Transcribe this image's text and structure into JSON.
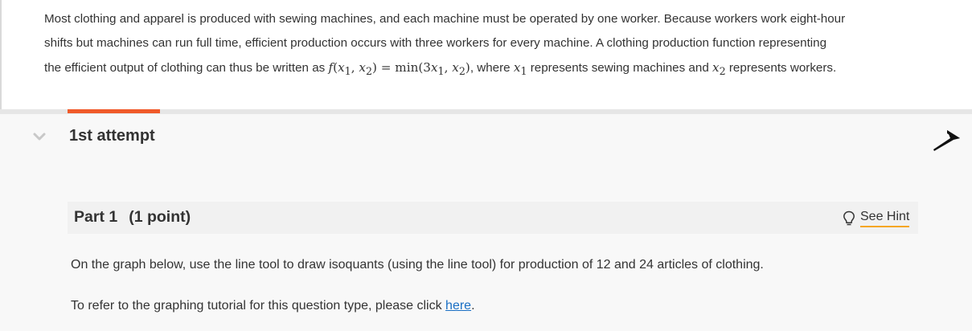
{
  "intro": {
    "line1": "Most clothing and apparel is produced with sewing machines, and each machine must be operated by one worker. Because workers work eight-hour",
    "line2": "shifts but machines can run full time, efficient production occurs with three workers for every machine. A clothing production function representing",
    "line3_prefix": "the efficient output of clothing can thus be written as",
    "line3_mid": ", where",
    "line3_mid2": "represents sewing machines and",
    "line3_suffix": "represents workers."
  },
  "attempt": {
    "title": "1st attempt"
  },
  "part": {
    "title": "Part 1",
    "points": "(1 point)",
    "hint_label": "See Hint"
  },
  "question": {
    "text": "On the graph below, use the line tool to draw isoquants (using the line tool) for production of 12 and 24 articles of clothing.",
    "tutorial_prefix": "To refer to the graphing tutorial for this question type, please click",
    "tutorial_link": "here",
    "tutorial_suffix": "."
  },
  "colors": {
    "accent_tab": "#f05a2a",
    "hint_underline": "#f5a623",
    "link": "#1a6fc4"
  },
  "icons": {
    "collapse": "chevron-down-icon",
    "pin": "pin-icon",
    "hint": "lightbulb-icon"
  }
}
